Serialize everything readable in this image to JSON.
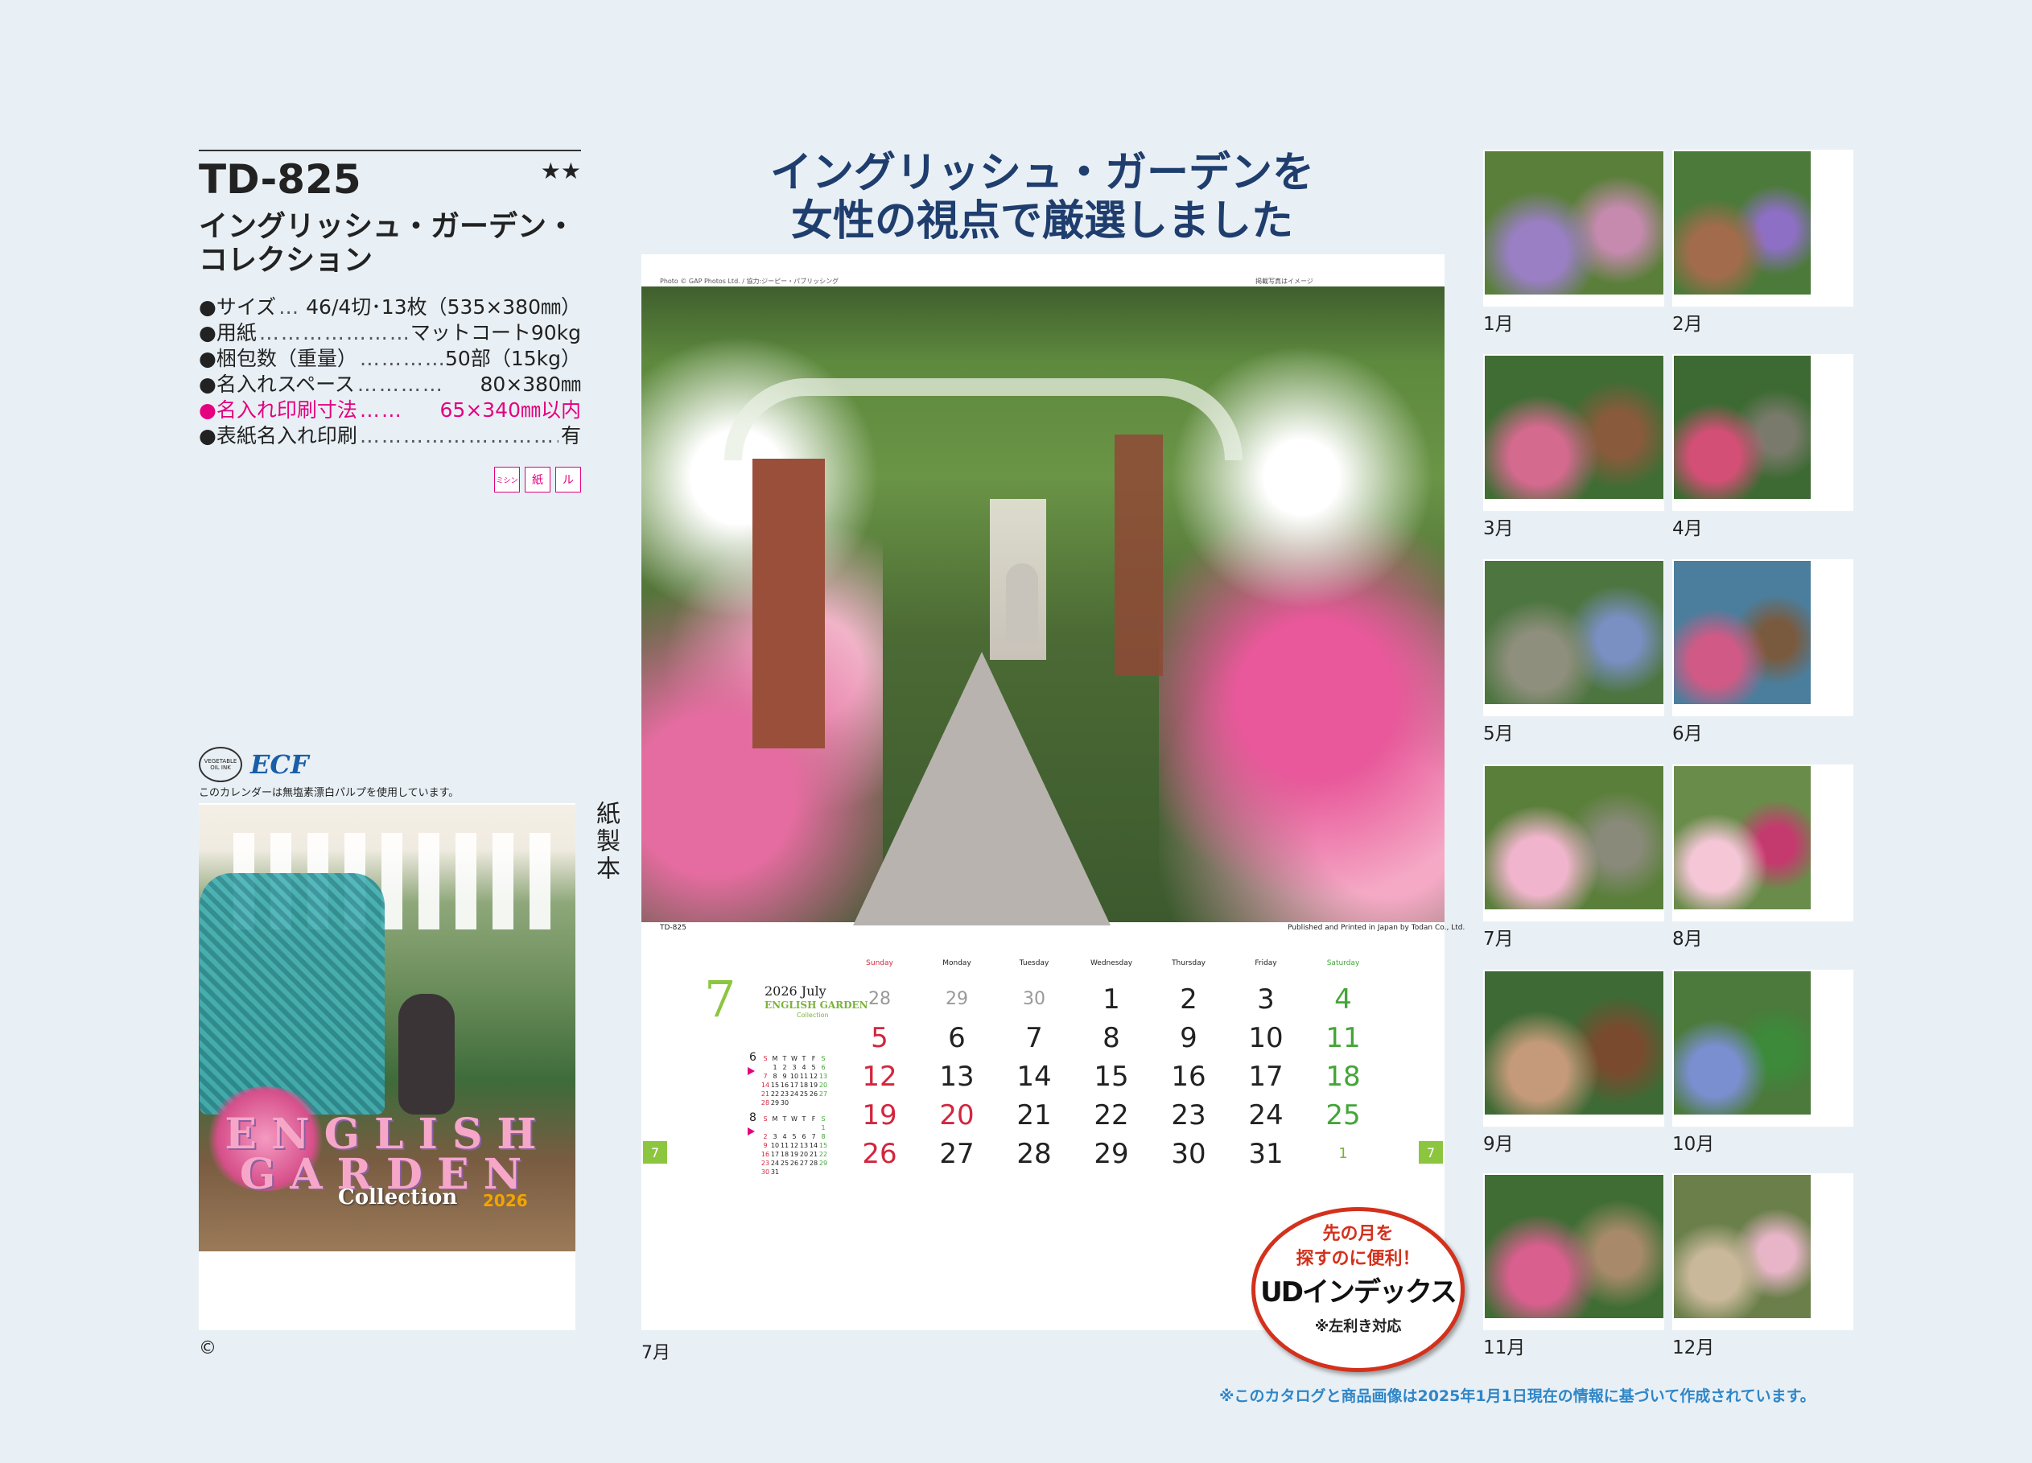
{
  "product": {
    "code": "TD-825",
    "stars": "★★",
    "name_line1": "イングリッシュ・ガーデン・",
    "name_line2": "コレクション",
    "specs": [
      {
        "label": "●サイズ",
        "dots": "…",
        "value": "46/4切･13枚（535×380㎜）"
      },
      {
        "label": "●用紙",
        "dots": "……………………",
        "value": "マットコート90kg"
      },
      {
        "label": "●梱包数（重量）",
        "dots": "…………",
        "value": "50部（15kg）"
      },
      {
        "label": "●名入れスペース",
        "dots": "…………",
        "value": "80×380㎜"
      },
      {
        "label": "●名入れ印刷寸法",
        "dots": "……",
        "value": "65×340㎜以内"
      },
      {
        "label": "●表紙名入れ印刷",
        "dots": "…………………………",
        "value": "有"
      }
    ],
    "tags": [
      "ミシン",
      "紙",
      "ル"
    ]
  },
  "cover": {
    "veg_ink": "VEGETABLE OIL INK",
    "ecf": "ECF",
    "ecf_note": "このカレンダーは無塩素漂白パルプを使用しています。",
    "title": "ENGLISH GARDEN",
    "collection": "Collection",
    "year": "2026",
    "vertical_label": "紙製本",
    "copyright": "©"
  },
  "headline": {
    "line1": "イングリッシュ・ガーデンを",
    "line2": "女性の視点で厳選しました"
  },
  "sheet": {
    "photo_credit": "Photo © GAP Photos Ltd. / 協力:ジーピー・パブリッシング",
    "photo_note": "掲載写真はイメージ",
    "code": "TD-825",
    "publisher": "Published and Printed in Japan by Todan Co., Ltd.",
    "month_num": "7",
    "year_label": "2026 July",
    "eng_title": "ENGLISH GARDEN",
    "eng_sub": "Collection",
    "tab": "7",
    "weekdays": [
      "Sunday",
      "Monday",
      "Tuesday",
      "Wednesday",
      "Thursday",
      "Friday",
      "Saturday"
    ],
    "weeks": [
      [
        "28",
        "29",
        "30",
        "1",
        "2",
        "3",
        "4"
      ],
      [
        "5",
        "6",
        "7",
        "8",
        "9",
        "10",
        "11"
      ],
      [
        "12",
        "13",
        "14",
        "15",
        "16",
        "17",
        "18"
      ],
      [
        "19",
        "20",
        "21",
        "22",
        "23",
        "24",
        "25"
      ],
      [
        "26",
        "27",
        "28",
        "29",
        "30",
        "31",
        "1"
      ]
    ],
    "mini_prev": {
      "month": "6",
      "head": [
        "S",
        "M",
        "T",
        "W",
        "T",
        "F",
        "S"
      ],
      "rows": [
        [
          "",
          "1",
          "2",
          "3",
          "4",
          "5",
          "6"
        ],
        [
          "7",
          "8",
          "9",
          "10",
          "11",
          "12",
          "13"
        ],
        [
          "14",
          "15",
          "16",
          "17",
          "18",
          "19",
          "20"
        ],
        [
          "21",
          "22",
          "23",
          "24",
          "25",
          "26",
          "27"
        ],
        [
          "28",
          "29",
          "30",
          "",
          "",
          "",
          ""
        ]
      ]
    },
    "mini_next": {
      "month": "8",
      "head": [
        "S",
        "M",
        "T",
        "W",
        "T",
        "F",
        "S"
      ],
      "rows": [
        [
          "",
          "",
          "",
          "",
          "",
          "",
          "1"
        ],
        [
          "2",
          "3",
          "4",
          "5",
          "6",
          "7",
          "8"
        ],
        [
          "9",
          "10",
          "11",
          "12",
          "13",
          "14",
          "15"
        ],
        [
          "16",
          "17",
          "18",
          "19",
          "20",
          "21",
          "22"
        ],
        [
          "23",
          "24",
          "25",
          "26",
          "27",
          "28",
          "29"
        ],
        [
          "30",
          "31",
          "",
          "",
          "",
          "",
          ""
        ]
      ]
    },
    "month_label": "7月"
  },
  "ud_badge": {
    "line1": "先の月を",
    "line2": "探すのに便利！",
    "main": "UDインデックス",
    "sub": "※左利き対応"
  },
  "thumbnails": [
    "1月",
    "2月",
    "3月",
    "4月",
    "5月",
    "6月",
    "7月",
    "8月",
    "9月",
    "10月",
    "11月",
    "12月"
  ],
  "footnote": "※このカタログと商品画像は2025年1月1日現在の情報に基づいて作成されています。",
  "colors": {
    "background": "#e9f0f5",
    "headline": "#1f3e6e",
    "pink_highlight": "#e4007f",
    "sunday": "#d3263e",
    "saturday": "#44a539",
    "accent_green": "#8cc63f",
    "badge_red": "#d3311c",
    "footnote_blue": "#2f86c8"
  }
}
